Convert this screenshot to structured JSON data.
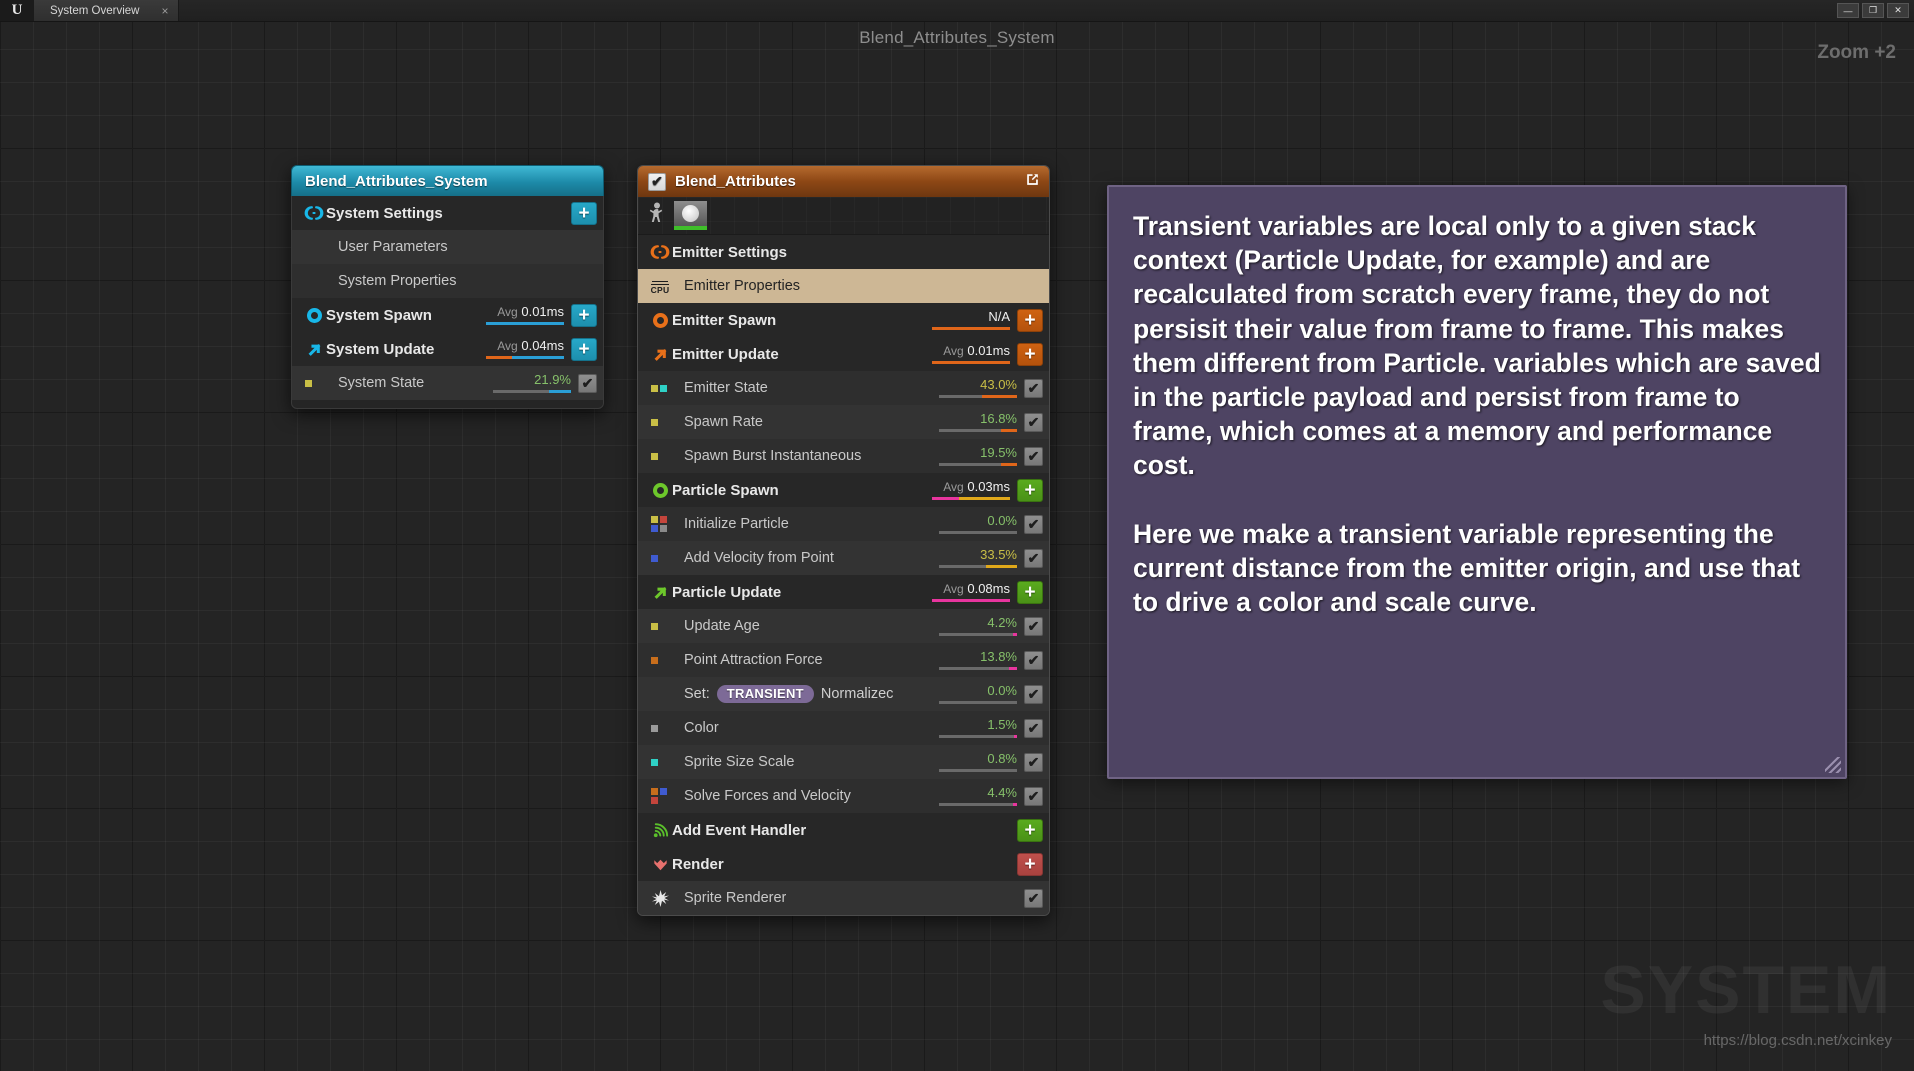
{
  "titlebar": {
    "logo": "U",
    "tab_label": "System Overview",
    "tab_close": "×",
    "minimize": "—",
    "maximize": "❐",
    "close": "✕"
  },
  "graph": {
    "title": "Blend_Attributes_System",
    "zoom_label": "Zoom +2",
    "watermark": "SYSTEM",
    "watermark_url": "https://blog.csdn.net/xcinkey"
  },
  "system_node": {
    "title": "Blend_Attributes_System",
    "rows": [
      {
        "label": "System Settings",
        "icon": "system-settings-icon",
        "type": "group",
        "accent": "#18b7e8",
        "button": "+"
      },
      {
        "label": "User Parameters",
        "icon": "none",
        "type": "child"
      },
      {
        "label": "System Properties",
        "icon": "none",
        "type": "child"
      },
      {
        "label": "System Spawn",
        "icon": "system-spawn-icon",
        "type": "group",
        "accent": "#18b7e8",
        "avg_prefix": "Avg",
        "value": "0.01ms",
        "button": "+",
        "bar": [
          {
            "color": "#2a9fd6",
            "pct": 100
          }
        ]
      },
      {
        "label": "System Update",
        "icon": "system-update-icon",
        "type": "group",
        "accent": "#18b7e8",
        "avg_prefix": "Avg",
        "value": "0.04ms",
        "button": "+",
        "bar": [
          {
            "color": "#e0661a",
            "pct": 33
          },
          {
            "color": "#2a9fd6",
            "pct": 67
          }
        ]
      },
      {
        "label": "System State",
        "icon": "dot",
        "type": "module",
        "dots": [
          "#c9bf46"
        ],
        "pct": "21.9%",
        "pct_class": "green",
        "checked": true,
        "bar": [
          {
            "color": "#6a6a6a",
            "pct": 72
          },
          {
            "color": "#2a9fd6",
            "pct": 28
          }
        ]
      }
    ]
  },
  "emitter_node": {
    "title": "Blend_Attributes",
    "header_checked": "✔",
    "open_icon": "↗",
    "thumbnail_label": "emitter-thumbnail",
    "rows": [
      {
        "label": "Emitter Settings",
        "icon": "emitter-settings-icon",
        "type": "group",
        "accent": "#e8701a"
      },
      {
        "label": "Emitter Properties",
        "icon": "cpu-icon",
        "type": "properties"
      },
      {
        "label": "Emitter Spawn",
        "icon": "emitter-spawn-icon",
        "type": "group",
        "accent": "#e8701a",
        "value": "N/A",
        "button": "+",
        "button_color": "orange",
        "bar": [
          {
            "color": "#e0661a",
            "pct": 100
          }
        ]
      },
      {
        "label": "Emitter Update",
        "icon": "emitter-update-icon",
        "type": "group",
        "accent": "#e8701a",
        "avg_prefix": "Avg",
        "value": "0.01ms",
        "button": "+",
        "button_color": "orange",
        "bar": [
          {
            "color": "#e0661a",
            "pct": 100
          }
        ]
      },
      {
        "label": "Emitter State",
        "icon": "dots",
        "type": "module",
        "dots": [
          "#c9bf46",
          "#2fd1c6"
        ],
        "pct": "43.0%",
        "pct_class": "yellow",
        "checked": true,
        "bar": [
          {
            "color": "#6a6a6a",
            "pct": 55
          },
          {
            "color": "#e0661a",
            "pct": 45
          }
        ]
      },
      {
        "label": "Spawn Rate",
        "icon": "dots",
        "type": "module",
        "dots": [
          "#c9bf46"
        ],
        "pct": "16.8%",
        "pct_class": "green",
        "checked": true,
        "bar": [
          {
            "color": "#6a6a6a",
            "pct": 80
          },
          {
            "color": "#e0661a",
            "pct": 20
          }
        ]
      },
      {
        "label": "Spawn Burst Instantaneous",
        "icon": "dots",
        "type": "module",
        "dots": [
          "#c9bf46"
        ],
        "pct": "19.5%",
        "pct_class": "green",
        "checked": true,
        "bar": [
          {
            "color": "#6a6a6a",
            "pct": 80
          },
          {
            "color": "#e0661a",
            "pct": 20
          }
        ]
      },
      {
        "label": "Particle Spawn",
        "icon": "particle-spawn-icon",
        "type": "group",
        "accent": "#6dc72b",
        "avg_prefix": "Avg",
        "value": "0.03ms",
        "button": "+",
        "button_color": "green",
        "bar": [
          {
            "color": "#e8359e",
            "pct": 35
          },
          {
            "color": "#e0a81a",
            "pct": 65
          }
        ]
      },
      {
        "label": "Initialize Particle",
        "icon": "dots",
        "type": "module",
        "dots": [
          "#c9bf46",
          "#c4453c",
          "#3f5bd0",
          "#8a8a8a"
        ],
        "pct": "0.0%",
        "pct_class": "green",
        "checked": true,
        "bar": [
          {
            "color": "#6a6a6a",
            "pct": 100
          }
        ]
      },
      {
        "label": "Add Velocity from Point",
        "icon": "dots",
        "type": "module",
        "dots": [
          "#3f5bd0"
        ],
        "pct": "33.5%",
        "pct_class": "yellow",
        "checked": true,
        "bar": [
          {
            "color": "#6a6a6a",
            "pct": 60
          },
          {
            "color": "#e0a81a",
            "pct": 40
          }
        ]
      },
      {
        "label": "Particle Update",
        "icon": "particle-update-icon",
        "type": "group",
        "accent": "#6dc72b",
        "avg_prefix": "Avg",
        "value": "0.08ms",
        "button": "+",
        "button_color": "green",
        "bar": [
          {
            "color": "#e8359e",
            "pct": 100
          }
        ]
      },
      {
        "label": "Update Age",
        "icon": "dots",
        "type": "module",
        "dots": [
          "#c9bf46"
        ],
        "pct": "4.2%",
        "pct_class": "green",
        "checked": true,
        "bar": [
          {
            "color": "#6a6a6a",
            "pct": 95
          },
          {
            "color": "#e8359e",
            "pct": 5
          }
        ]
      },
      {
        "label": "Point Attraction Force",
        "icon": "dots",
        "type": "module",
        "dots": [
          "#c86e1c"
        ],
        "pct": "13.8%",
        "pct_class": "green",
        "checked": true,
        "bar": [
          {
            "color": "#6a6a6a",
            "pct": 90
          },
          {
            "color": "#e8359e",
            "pct": 10
          }
        ]
      },
      {
        "label": "Set:",
        "label2": "Normalizec",
        "badge": "TRANSIENT",
        "icon": "none",
        "type": "set",
        "pct": "0.0%",
        "pct_class": "green",
        "checked": true,
        "bar": [
          {
            "color": "#6a6a6a",
            "pct": 100
          }
        ]
      },
      {
        "label": "Color",
        "icon": "dots",
        "type": "module",
        "dots": [
          "#9a9a9a"
        ],
        "pct": "1.5%",
        "pct_class": "green",
        "checked": true,
        "bar": [
          {
            "color": "#6a6a6a",
            "pct": 96
          },
          {
            "color": "#e8359e",
            "pct": 4
          }
        ]
      },
      {
        "label": "Sprite Size Scale",
        "icon": "dots",
        "type": "module",
        "dots": [
          "#2fd1c6"
        ],
        "pct": "0.8%",
        "pct_class": "green",
        "checked": true,
        "bar": [
          {
            "color": "#6a6a6a",
            "pct": 100
          }
        ]
      },
      {
        "label": "Solve Forces and Velocity",
        "icon": "dots",
        "type": "module",
        "dots": [
          "#c86e1c",
          "#3f5bd0",
          "#c4453c"
        ],
        "pct": "4.4%",
        "pct_class": "green",
        "checked": true,
        "bar": [
          {
            "color": "#6a6a6a",
            "pct": 95
          },
          {
            "color": "#e8359e",
            "pct": 5
          }
        ]
      },
      {
        "label": "Add Event Handler",
        "icon": "event-handler-icon",
        "type": "group",
        "accent": "#5bc02b",
        "button": "+",
        "button_color": "green"
      },
      {
        "label": "Render",
        "icon": "render-icon",
        "type": "group",
        "accent": "#e8716e",
        "button": "+",
        "button_color": "red"
      },
      {
        "label": "Sprite Renderer",
        "icon": "sprite-renderer-icon",
        "type": "module_icon",
        "checked": true
      }
    ]
  },
  "comment": {
    "text": "Transient variables are local only to a given stack context (Particle Update, for example) and are recalculated from scratch every frame, they do not persisit their value from frame to frame. This makes them different from Particle. variables which are saved in the particle payload and persist from frame to frame, which comes at a memory and performance cost.\n\nHere we make a transient variable representing the current distance from the emitter origin, and use that to drive a color and scale curve."
  }
}
